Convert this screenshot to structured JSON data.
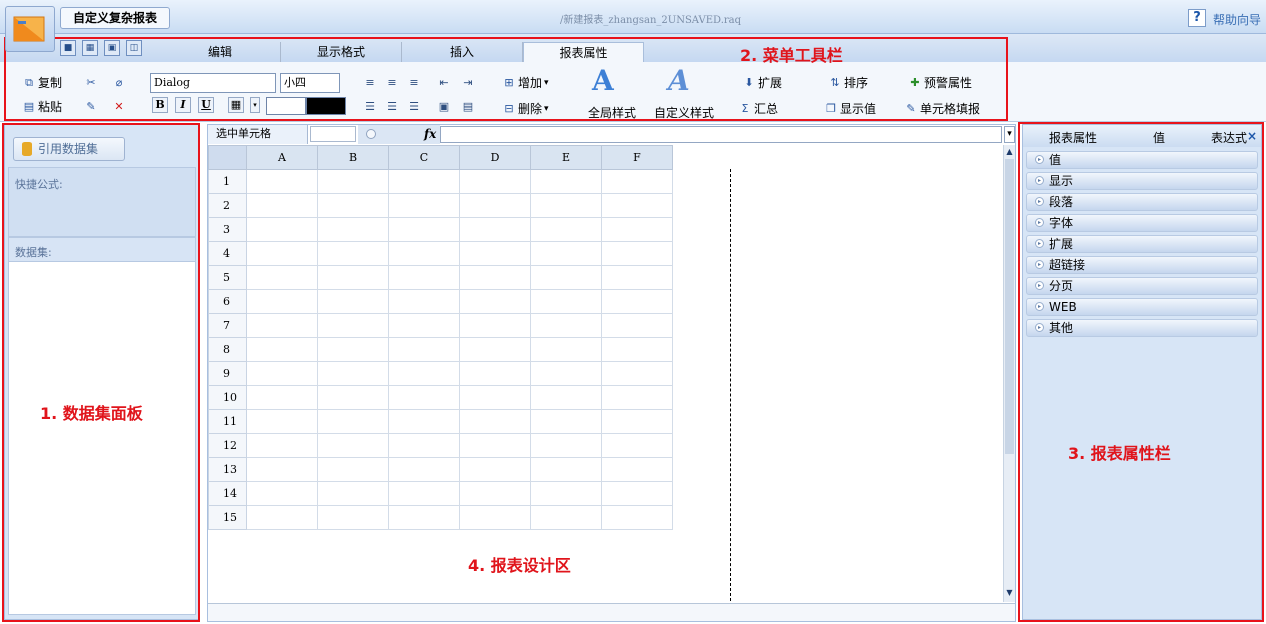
{
  "title_bar": {
    "doc_tab": "自定义复杂报表",
    "file_path": "/新建报表_zhangsan_2UNSAVED.raq",
    "help_icon": "?",
    "help_label": "帮助向导"
  },
  "ribbon": {
    "tabs": [
      "编辑",
      "显示格式",
      "插入",
      "报表属性"
    ],
    "active_tab": "报表属性",
    "copy": "复制",
    "paste": "粘贴",
    "font_name": "Dialog",
    "font_size": "小四",
    "bold": "B",
    "italic": "I",
    "underline": "U",
    "add": "增加",
    "delete": "删除",
    "global_style": "全局样式",
    "custom_style": "自定义样式",
    "expand": "扩展",
    "summary": "汇总",
    "sort": "排序",
    "display_value": "显示值",
    "warning_props": "预警属性",
    "cell_fill": "单元格填报",
    "fill_color": "#ffffff",
    "text_color": "#000000"
  },
  "left_panel": {
    "dataset_button": "引用数据集",
    "quick_formula_label": "快捷公式:",
    "dataset_label": "数据集:"
  },
  "center": {
    "cell_ref_label": "选中单元格",
    "fx": "fx",
    "columns": [
      "A",
      "B",
      "C",
      "D",
      "E",
      "F"
    ],
    "rows": [
      "1",
      "2",
      "3",
      "4",
      "5",
      "6",
      "7",
      "8",
      "9",
      "10",
      "11",
      "12",
      "13",
      "14",
      "15"
    ]
  },
  "right_panel": {
    "headers": [
      "报表属性",
      "值",
      "表达式"
    ],
    "close_icon": "×",
    "sections": [
      "值",
      "显示",
      "段落",
      "字体",
      "扩展",
      "超链接",
      "分页",
      "WEB",
      "其他"
    ]
  },
  "annotations": {
    "dataset_panel": "1. 数据集面板",
    "menu_toolbar": "2. 菜单工具栏",
    "report_props": "3. 报表属性栏",
    "design_area": "4. 报表设计区",
    "color": "#e0141b"
  }
}
